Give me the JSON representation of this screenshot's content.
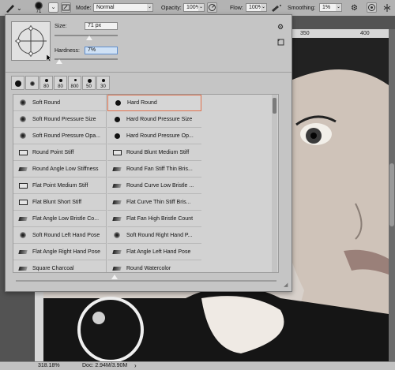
{
  "options_bar": {
    "brush_size": "71",
    "mode_label": "Mode:",
    "mode_value": "Normal",
    "opacity_label": "Opacity:",
    "opacity_value": "100%",
    "flow_label": "Flow:",
    "flow_value": "100%",
    "smoothing_label": "Smoothing:",
    "smoothing_value": "1%"
  },
  "brush_panel": {
    "size_label": "Size:",
    "size_value": "71 px",
    "size_fraction": 0.55,
    "hardness_label": "Hardness:",
    "hardness_value": "7%",
    "hardness_fraction": 0.07,
    "presets": [
      "",
      "",
      "80",
      "80",
      "800",
      "50",
      "30"
    ],
    "brushes": [
      [
        "Soft Round",
        "Hard Round"
      ],
      [
        "Soft Round Pressure Size",
        "Hard Round Pressure Size"
      ],
      [
        "Soft Round Pressure Opa...",
        "Hard Round Pressure Op..."
      ],
      [
        "Round Point Stiff",
        "Round Blunt Medium Stiff"
      ],
      [
        "Round Angle Low Stiffness",
        "Round Fan Stiff Thin Bris..."
      ],
      [
        "Flat Point Medium Stiff",
        "Round Curve Low Bristle ..."
      ],
      [
        "Flat Blunt Short Stiff",
        "Flat Curve Thin Stiff Bris..."
      ],
      [
        "Flat Angle Low Bristle Co...",
        "Flat Fan High Bristle Count"
      ],
      [
        "Soft Round Left Hand Pose",
        "Soft Round Right Hand P..."
      ],
      [
        "Flat Angle Right Hand Pose",
        "Flat Angle Left Hand Pose"
      ],
      [
        "Square Charcoal",
        "Round Watercolor"
      ]
    ],
    "selected_brush": "Hard Round"
  },
  "canvas": {
    "ruler_mark": "350",
    "ruler_mark_2": "400"
  },
  "status_bar": {
    "zoom": "318.18%",
    "doc": "Doc: 2.94M/3.90M"
  }
}
